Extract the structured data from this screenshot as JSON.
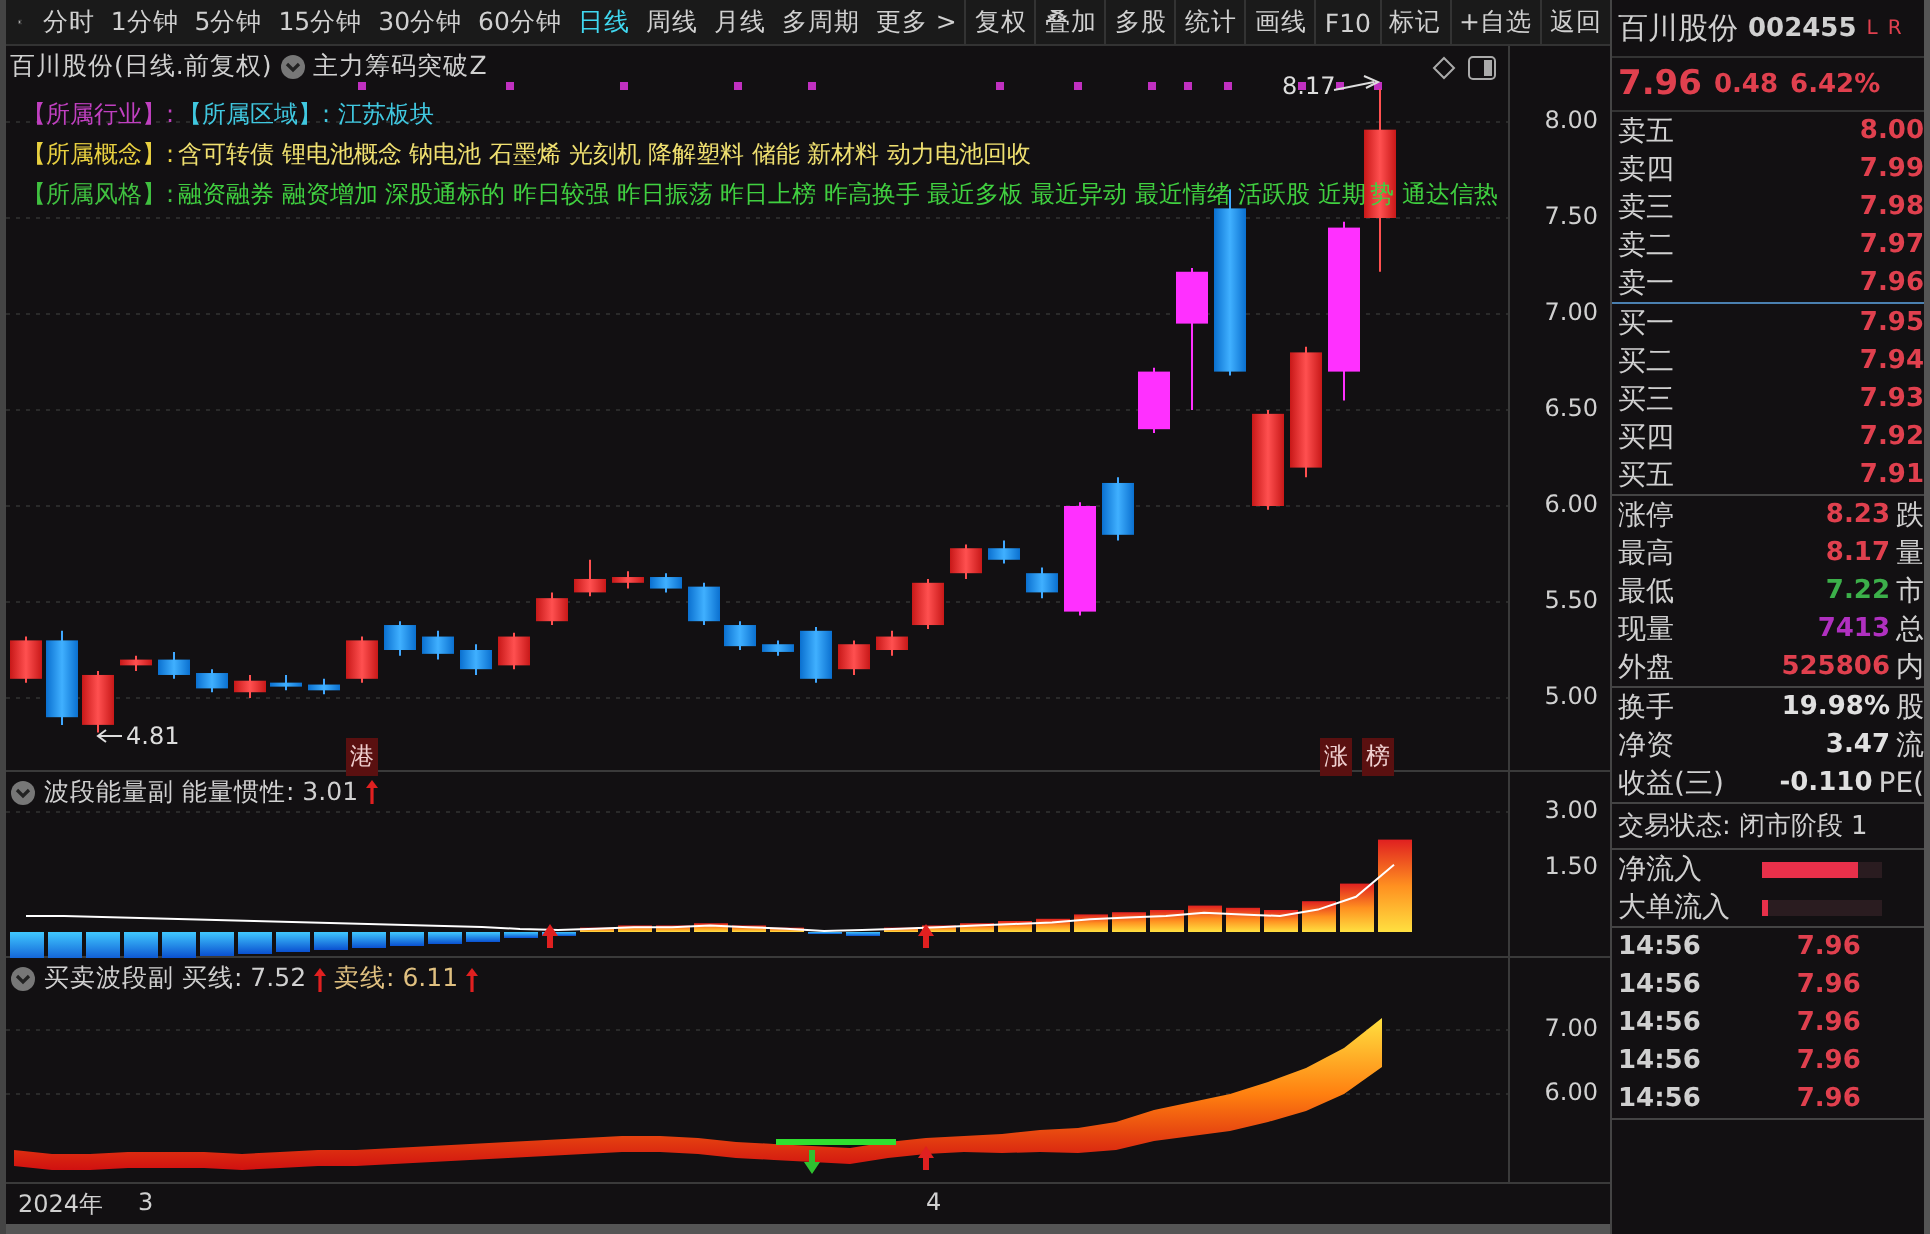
{
  "toolbar": {
    "tabs": [
      {
        "label": "分时",
        "selected": false
      },
      {
        "label": "1分钟",
        "selected": false
      },
      {
        "label": "5分钟",
        "selected": false
      },
      {
        "label": "15分钟",
        "selected": false
      },
      {
        "label": "30分钟",
        "selected": false
      },
      {
        "label": "60分钟",
        "selected": false
      },
      {
        "label": "日线",
        "selected": true
      },
      {
        "label": "周线",
        "selected": false
      },
      {
        "label": "月线",
        "selected": false
      },
      {
        "label": "多周期",
        "selected": false
      },
      {
        "label": "更多 >",
        "selected": false
      }
    ],
    "buttons": [
      "复权",
      "叠加",
      "多股",
      "统计",
      "画线",
      "F10",
      "标记",
      "+自选",
      "返回"
    ]
  },
  "chart": {
    "title": "百川股份(日线.前复权)",
    "indicator": "主力筹码突破Z",
    "info": [
      {
        "segments": [
          {
            "text": "【所属行业】:",
            "color": "#c040c0"
          },
          {
            "text": "【所属区域】: 江苏板块",
            "color": "#40c8e0"
          }
        ]
      },
      {
        "segments": [
          {
            "text": "【所属概念】:",
            "color": "#e8d040"
          },
          {
            "text": "含可转债 锂电池概念 钠电池 石墨烯 光刻机 降解塑料 储能 新材料 动力电池回收",
            "color": "#f0e070"
          }
        ]
      },
      {
        "segments": [
          {
            "text": "【所属风格】:",
            "color": "#40c040"
          },
          {
            "text": "融资融券 融资增加 深股通标的 昨日较强 昨日振荡 昨日上榜 昨高换手 最近多板 最近异动 最近情绪 活跃股 近期",
            "color": "#40d040"
          },
          {
            "text": "势 通达信热",
            "color": "#40d040"
          }
        ]
      }
    ],
    "high_label": "8.17",
    "low_label": "4.81",
    "markers": [
      "港",
      "涨",
      "榜"
    ],
    "price_axis": [
      "8.00",
      "7.50",
      "7.00",
      "6.50",
      "6.00",
      "5.50",
      "5.00"
    ]
  },
  "energy_panel": {
    "name": "波段能量副",
    "reading": "能量惯性: 3.01",
    "axis": [
      "3.00",
      "1.50"
    ]
  },
  "band_panel": {
    "name": "买卖波段副",
    "buy": "买线: 7.52",
    "sell": "卖线: 6.11",
    "axis": [
      "7.00",
      "6.00"
    ]
  },
  "date_axis": [
    "2024年",
    "3",
    "4"
  ],
  "quote": {
    "name": "百川股份",
    "code": "002455",
    "flags": [
      "L",
      "R"
    ],
    "price": "7.96",
    "change": "0.48",
    "percent": "6.42%",
    "order_book": [
      {
        "label": "卖五",
        "price": "8.00"
      },
      {
        "label": "卖四",
        "price": "7.99"
      },
      {
        "label": "卖三",
        "price": "7.98"
      },
      {
        "label": "卖二",
        "price": "7.97"
      },
      {
        "label": "卖一",
        "price": "7.96"
      },
      {
        "label": "买一",
        "price": "7.95"
      },
      {
        "label": "买二",
        "price": "7.94"
      },
      {
        "label": "买三",
        "price": "7.93"
      },
      {
        "label": "买四",
        "price": "7.92"
      },
      {
        "label": "买五",
        "price": "7.91"
      }
    ],
    "stats": [
      {
        "label": "涨停",
        "value": "8.23",
        "color": "#e0404e",
        "next": "跌"
      },
      {
        "label": "最高",
        "value": "8.17",
        "color": "#e0404e",
        "next": "量"
      },
      {
        "label": "最低",
        "value": "7.22",
        "color": "#3cb04a",
        "next": "市"
      },
      {
        "label": "现量",
        "value": "7413",
        "color": "#b030c0",
        "next": "总"
      },
      {
        "label": "外盘",
        "value": "525806",
        "color": "#e0404e",
        "next": "内"
      }
    ],
    "info": [
      {
        "label": "换手",
        "value": "19.98%",
        "next": "股"
      },
      {
        "label": "净资",
        "value": "3.47",
        "next": "流"
      },
      {
        "label": "收益(三)",
        "value": "-0.110",
        "next": "PE("
      }
    ],
    "status": {
      "label": "交易状态:",
      "value": "闭市阶段 1"
    },
    "flows": [
      {
        "label": "净流入",
        "level": 0.8
      },
      {
        "label": "大单流入",
        "level": 0.05
      }
    ],
    "ticks": [
      {
        "time": "14:56",
        "price": "7.96"
      },
      {
        "time": "14:56",
        "price": "7.96"
      },
      {
        "time": "14:56",
        "price": "7.96"
      },
      {
        "time": "14:56",
        "price": "7.96"
      },
      {
        "time": "14:56",
        "price": "7.96"
      }
    ]
  }
}
